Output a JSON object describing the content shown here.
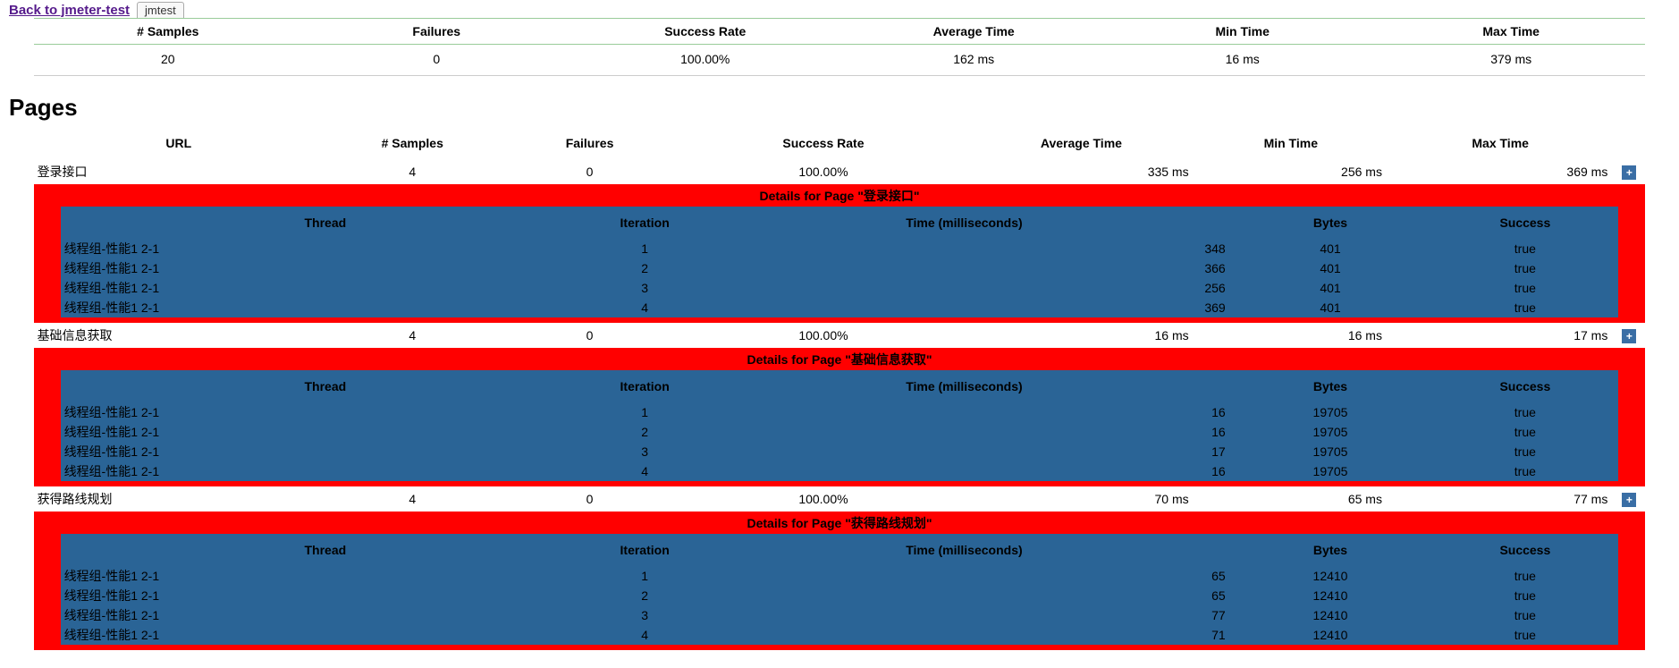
{
  "nav": {
    "back_label": "Back to jmeter-test",
    "tab_label": "jmtest"
  },
  "summary": {
    "headers": [
      "# Samples",
      "Failures",
      "Success Rate",
      "Average Time",
      "Min Time",
      "Max Time"
    ],
    "row": [
      "20",
      "0",
      "100.00%",
      "162 ms",
      "16 ms",
      "379 ms"
    ]
  },
  "section_title": "Pages",
  "pages_headers": [
    "URL",
    "# Samples",
    "Failures",
    "Success Rate",
    "Average Time",
    "Min Time",
    "Max Time"
  ],
  "detail_headers": {
    "thread": "Thread",
    "iter": "Iteration",
    "time": "Time (milliseconds)",
    "bytes": "Bytes",
    "succ": "Success"
  },
  "detail_prefix": "Details for Page",
  "plus": "+",
  "pages": [
    {
      "url": "登录接口",
      "samples": "4",
      "failures": "0",
      "rate": "100.00%",
      "avg": "335 ms",
      "min": "256 ms",
      "max": "369 ms",
      "details": [
        {
          "thread": "线程组-性能1 2-1",
          "iter": "1",
          "time": "348",
          "bytes": "401",
          "succ": "true"
        },
        {
          "thread": "线程组-性能1 2-1",
          "iter": "2",
          "time": "366",
          "bytes": "401",
          "succ": "true"
        },
        {
          "thread": "线程组-性能1 2-1",
          "iter": "3",
          "time": "256",
          "bytes": "401",
          "succ": "true"
        },
        {
          "thread": "线程组-性能1 2-1",
          "iter": "4",
          "time": "369",
          "bytes": "401",
          "succ": "true"
        }
      ]
    },
    {
      "url": "基础信息获取",
      "samples": "4",
      "failures": "0",
      "rate": "100.00%",
      "avg": "16 ms",
      "min": "16 ms",
      "max": "17 ms",
      "details": [
        {
          "thread": "线程组-性能1 2-1",
          "iter": "1",
          "time": "16",
          "bytes": "19705",
          "succ": "true"
        },
        {
          "thread": "线程组-性能1 2-1",
          "iter": "2",
          "time": "16",
          "bytes": "19705",
          "succ": "true"
        },
        {
          "thread": "线程组-性能1 2-1",
          "iter": "3",
          "time": "17",
          "bytes": "19705",
          "succ": "true"
        },
        {
          "thread": "线程组-性能1 2-1",
          "iter": "4",
          "time": "16",
          "bytes": "19705",
          "succ": "true"
        }
      ]
    },
    {
      "url": "获得路线规划",
      "samples": "4",
      "failures": "0",
      "rate": "100.00%",
      "avg": "70 ms",
      "min": "65 ms",
      "max": "77 ms",
      "details": [
        {
          "thread": "线程组-性能1 2-1",
          "iter": "1",
          "time": "65",
          "bytes": "12410",
          "succ": "true"
        },
        {
          "thread": "线程组-性能1 2-1",
          "iter": "2",
          "time": "65",
          "bytes": "12410",
          "succ": "true"
        },
        {
          "thread": "线程组-性能1 2-1",
          "iter": "3",
          "time": "77",
          "bytes": "12410",
          "succ": "true"
        },
        {
          "thread": "线程组-性能1 2-1",
          "iter": "4",
          "time": "71",
          "bytes": "12410",
          "succ": "true"
        }
      ]
    }
  ]
}
